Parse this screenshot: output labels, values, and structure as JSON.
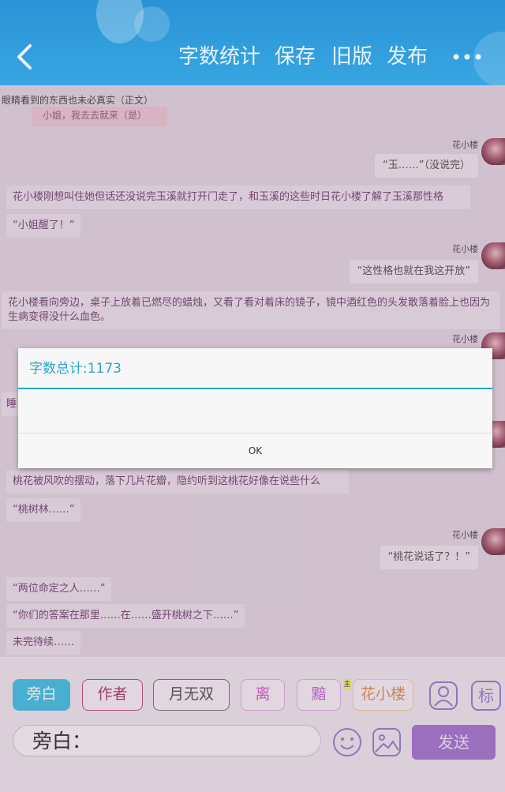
{
  "header": {
    "word_count_label": "字数统计",
    "save_label": "保存",
    "old_version_label": "旧版",
    "publish_label": "发布"
  },
  "story_title": "眼睛看到的东西也未必真实（正文）",
  "messages": {
    "top_chip": "小姐，我去去就来（是）",
    "m1_name": "花小楼",
    "m1_text": "“玉……”（没说完）",
    "n1": "花小楼刚想叫住她但话还没说完玉溪就打开门走了，和玉溪的这些时日花小楼了解了玉溪那性格",
    "n2": "“小姐醒了！”",
    "m2_name": "花小楼",
    "m2_text": "“这性格也就在我这开放”",
    "n3": "花小楼看向旁边，桌子上放着已燃尽的蜡烛，又看了看对着床的镜子，镜中酒红色的头发散落着脸上也因为生病变得没什么血色。",
    "m3_name": "花小楼",
    "n4_fragment": "睡",
    "n5": "桃花被风吹的摆动，落下几片花瓣，隐约听到这桃花好像在说些什么",
    "n6": "“桃树林……”",
    "m4_name": "花小楼",
    "m4_text": "“桃花说话了？！”",
    "n7": "“两位命定之人……”",
    "n8": "“你们的答案在那里……在……盛开桃树之下……”",
    "n9": "未完待续……"
  },
  "dialog": {
    "title": "字数总计:1173",
    "ok_label": "OK"
  },
  "roles": {
    "narrator": "旁白",
    "author": "作者",
    "yuewushuang": "月无双",
    "li": "离",
    "an": "黯",
    "main_badge": "主",
    "huaxiaolou": "花小楼",
    "tag_label": "标"
  },
  "composer": {
    "value": "旁白：",
    "send_label": "发送"
  },
  "colors": {
    "header": "#2a93d6",
    "accent": "#2aa6c8",
    "send": "#9c6fc8",
    "selected_chip": "#37bde0"
  }
}
